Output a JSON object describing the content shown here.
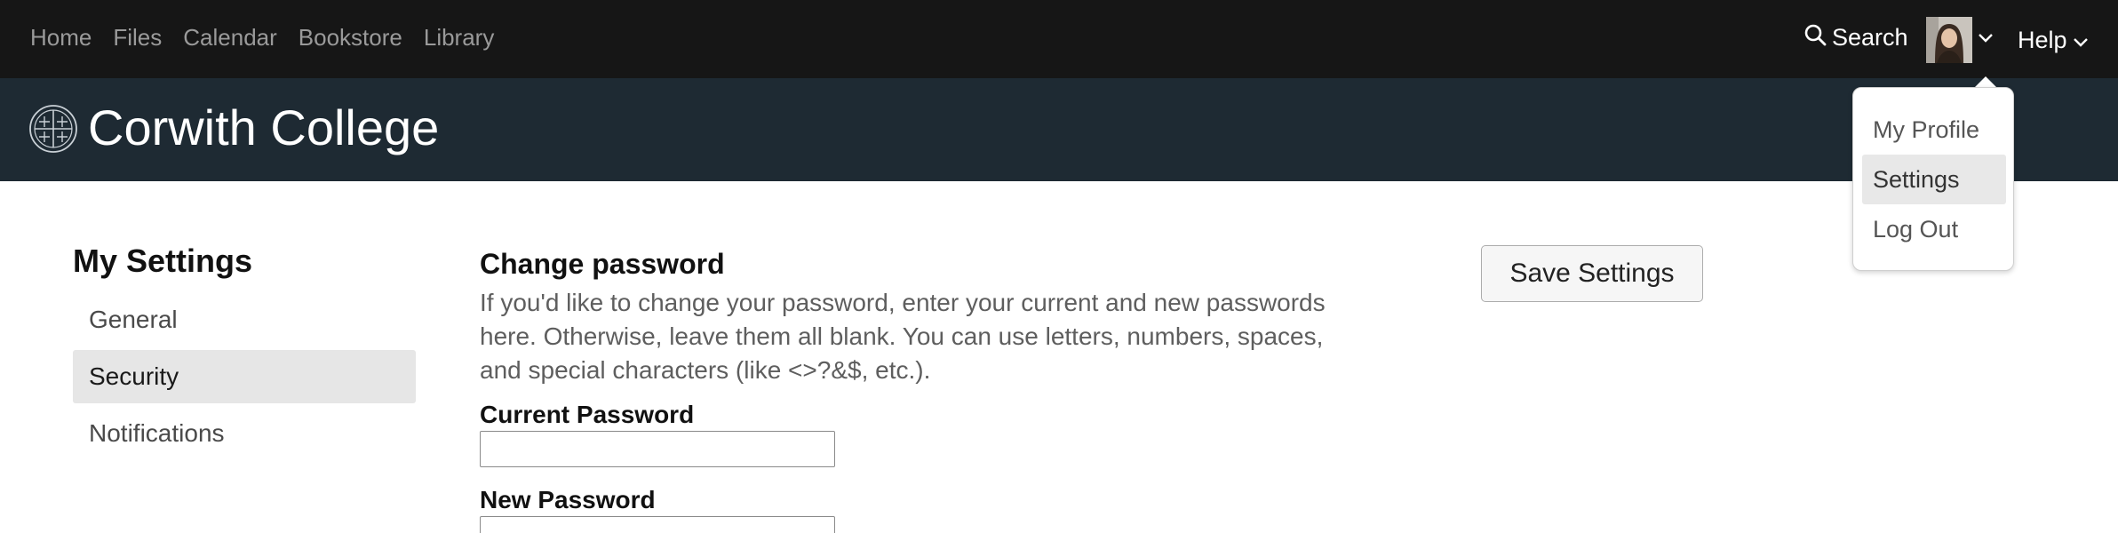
{
  "nav": {
    "links": [
      "Home",
      "Files",
      "Calendar",
      "Bookstore",
      "Library"
    ],
    "search_label": "Search",
    "help_label": "Help"
  },
  "header": {
    "college_name": "Corwith College"
  },
  "user_menu": {
    "items": [
      "My Profile",
      "Settings",
      "Log Out"
    ],
    "active": "Settings"
  },
  "sidebar": {
    "title": "My Settings",
    "items": [
      "General",
      "Security",
      "Notifications"
    ],
    "active": "Security"
  },
  "main": {
    "section_title": "Change password",
    "description": "If you'd like to change your password, enter your current and new passwords here. Otherwise, leave them all blank. You can use letters, numbers, spaces, and special characters (like <>?&$, etc.).",
    "fields": [
      {
        "label": "Current Password",
        "value": ""
      },
      {
        "label": "New Password",
        "value": ""
      }
    ]
  },
  "toolbar": {
    "save_label": "Save Settings"
  },
  "colors": {
    "topbar": "#161616",
    "header": "#1e2a33",
    "active_item_bg": "#e6e6e6"
  },
  "icons": {
    "search": "search-icon",
    "chevron": "chevron-down-icon",
    "seal": "college-seal-icon"
  }
}
